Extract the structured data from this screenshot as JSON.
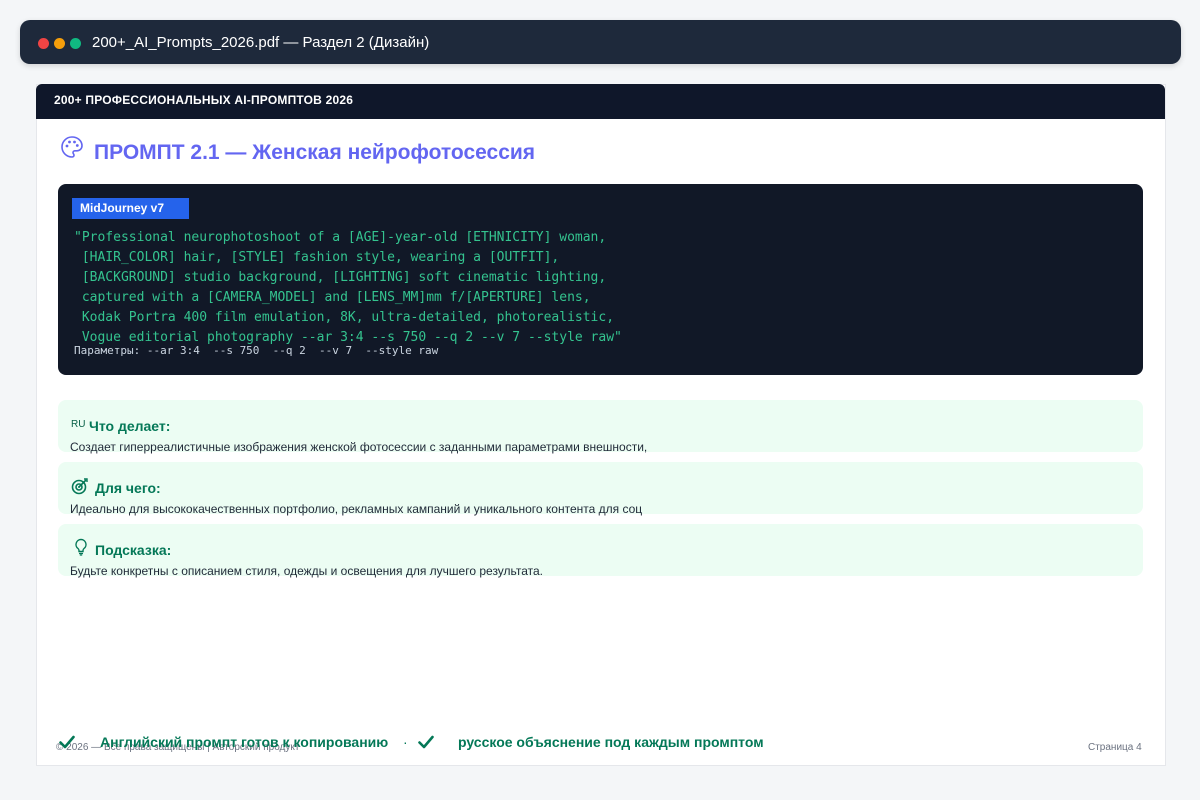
{
  "window": {
    "title": "200+_AI_Prompts_2026.pdf — Раздел 2 (Дизайн)"
  },
  "document": {
    "header": "200+ ПРОФЕССИОНАЛЬНЫХ AI-ПРОМПТОВ 2026",
    "prompt": {
      "title": "ПРОМПТ 2.1 — Женская нейрофотосессия",
      "model": "MidJourney v7",
      "code_lines": [
        "\"Professional neurophotoshoot of a [AGE]-year-old [ETHNICITY] woman,",
        " [HAIR_COLOR] hair, [STYLE] fashion style, wearing a [OUTFIT],",
        " [BACKGROUND] studio background, [LIGHTING] soft cinematic lighting,",
        " captured with a [CAMERA_MODEL] and [LENS_MM]mm f/[APERTURE] lens,",
        " Kodak Portra 400 film emulation, 8K, ultra-detailed, photorealistic,",
        " Vogue editorial photography --ar 3:4 --s 750 --q 2 --v 7 --style raw\""
      ],
      "params": "Параметры: --ar 3:4  --s 750  --q 2  --v 7  --style raw"
    },
    "cards": [
      {
        "icon": "ru-flag-icon",
        "icon_text": "RU",
        "heading": "Что делает:",
        "text": "Создает гиперреалистичные изображения женской фотосессии с заданными параметрами внешности,"
      },
      {
        "icon": "target-icon",
        "heading": "Для чего:",
        "text": "Идеально для высококачественных портфолио, рекламных кампаний и уникального контента для соц"
      },
      {
        "icon": "lightbulb-icon",
        "heading": "Подсказка:",
        "text": "Будьте конкретны с описанием стиля, одежды и освещения для лучшего результата."
      }
    ],
    "footer": {
      "copyright": "© 2026 — Все права защищены | Авторский продукт",
      "page": "Страница 4",
      "features": [
        "Английский промпт готов к копированию",
        "русское объяснение под каждым промптом"
      ],
      "separator": "·"
    }
  },
  "colors": {
    "titlebar": "#1e293b",
    "header": "#0f172a",
    "accent_title": "#6366f1",
    "code_bg": "#111827",
    "code_text": "#34c38f",
    "badge": "#2563eb",
    "card_bg": "#ecfdf3",
    "card_heading": "#047857"
  }
}
